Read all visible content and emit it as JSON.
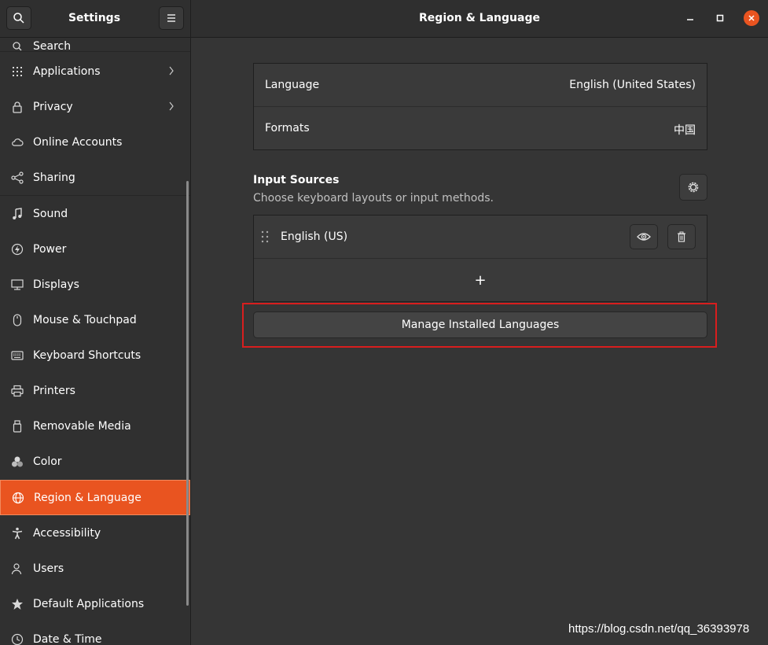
{
  "header": {
    "sidebar_title": "Settings",
    "page_title": "Region & Language"
  },
  "sidebar": {
    "partial_top_label": "Search",
    "items": [
      {
        "label": "Applications",
        "icon": "apps-grid-icon",
        "chevron": true
      },
      {
        "label": "Privacy",
        "icon": "lock-icon",
        "chevron": true
      },
      {
        "label": "Online Accounts",
        "icon": "cloud-icon"
      },
      {
        "label": "Sharing",
        "icon": "share-icon"
      },
      {
        "label": "Sound",
        "icon": "music-note-icon"
      },
      {
        "label": "Power",
        "icon": "power-icon"
      },
      {
        "label": "Displays",
        "icon": "display-icon"
      },
      {
        "label": "Mouse & Touchpad",
        "icon": "mouse-icon"
      },
      {
        "label": "Keyboard Shortcuts",
        "icon": "keyboard-icon"
      },
      {
        "label": "Printers",
        "icon": "printer-icon"
      },
      {
        "label": "Removable Media",
        "icon": "removable-media-icon"
      },
      {
        "label": "Color",
        "icon": "color-icon"
      },
      {
        "label": "Region & Language",
        "icon": "globe-icon",
        "active": true
      },
      {
        "label": "Accessibility",
        "icon": "accessibility-icon"
      },
      {
        "label": "Users",
        "icon": "user-icon"
      },
      {
        "label": "Default Applications",
        "icon": "star-icon"
      },
      {
        "label": "Date & Time",
        "icon": "clock-icon"
      }
    ]
  },
  "main": {
    "language_label": "Language",
    "language_value": "English (United States)",
    "formats_label": "Formats",
    "formats_value": "中国",
    "input_sources": {
      "title": "Input Sources",
      "subtitle": "Choose keyboard layouts or input methods.",
      "items": [
        {
          "label": "English (US)"
        }
      ],
      "add_symbol": "+"
    },
    "manage_button_label": "Manage Installed Languages"
  },
  "watermark": "https://blog.csdn.net/qq_36393978",
  "colors": {
    "accent": "#e95420",
    "highlight_box": "#d81e1e",
    "background": "#353535",
    "sidebar": "#303030"
  }
}
